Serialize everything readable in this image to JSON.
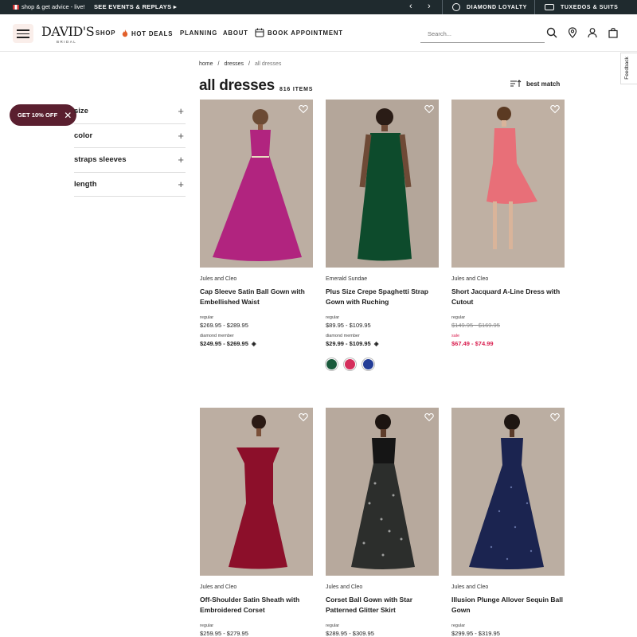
{
  "topbar": {
    "promo_text": "shop & get advice - live!",
    "events_text": "SEE EVENTS & REPLAYS",
    "prev_glyph": "‹",
    "next_glyph": "›",
    "loyalty_label": "DIAMOND LOYALTY",
    "tuxedos_label": "TUXEDOS & SUITS"
  },
  "header": {
    "logo": "DAVID'S",
    "logo_sub": "BRIDAL",
    "nav": {
      "shop": "SHOP",
      "hot_deals": "HOT DEALS",
      "planning": "PLANNING",
      "about": "ABOUT",
      "book": "BOOK APPOINTMENT"
    },
    "search_placeholder": "Search..."
  },
  "feedback_label": "Feedback",
  "breadcrumb": {
    "home": "home",
    "sep1": "/",
    "dresses": "dresses",
    "sep2": "/",
    "current": "all dresses"
  },
  "page": {
    "title": "all dresses",
    "count": "816 ITEMS",
    "sort_label": "best match"
  },
  "promo_pill": {
    "label": "GET 10% OFF",
    "close": "✕"
  },
  "filters": [
    {
      "label": "size",
      "plus": "+"
    },
    {
      "label": "color",
      "plus": "+"
    },
    {
      "label": "straps sleeves",
      "plus": "+"
    },
    {
      "label": "length",
      "plus": "+"
    }
  ],
  "colors": {
    "topbar_bg": "#1f2a2e",
    "pill_bg": "#5a1f2f",
    "sale_red": "#d91e4f",
    "image_bg": "#b9ab9e"
  },
  "products": [
    {
      "brand": "Jules and Cleo",
      "name": "Cap Sleeve Satin Ball Gown with Embellished Waist",
      "regular_label": "regular",
      "regular_price": "$269.95 - $289.95",
      "member_label": "diamond member",
      "member_price": "$249.95 - $269.95",
      "dress_color": "#b1247f"
    },
    {
      "brand": "Emerald Sundae",
      "name": "Plus Size Crepe Spaghetti Strap Gown with Ruching",
      "regular_label": "regular",
      "regular_price": "$89.95 - $109.95",
      "member_label": "diamond member",
      "member_price": "$29.99 - $109.95",
      "dress_color": "#0d4b2c",
      "swatches": [
        "#1a5a3c",
        "#d52e5c",
        "#233d97"
      ]
    },
    {
      "brand": "Jules and Cleo",
      "name": "Short Jacquard A-Line Dress with Cutout",
      "regular_label": "regular",
      "regular_price": "$149.95 - $169.95",
      "member_label": "sale",
      "member_price": "$67.49 - $74.99",
      "dress_color": "#e86f78"
    },
    {
      "brand": "Jules and Cleo",
      "name": "Off-Shoulder Satin Sheath with Embroidered Corset",
      "regular_label": "regular",
      "regular_price": "$259.95 - $279.95",
      "dress_color": "#8c0f2a"
    },
    {
      "brand": "Jules and Cleo",
      "name": "Corset Ball Gown with Star Patterned Glitter Skirt",
      "regular_label": "regular",
      "regular_price": "$289.95 - $309.95",
      "dress_color": "#2c2e2c"
    },
    {
      "brand": "Jules and Cleo",
      "name": "Illusion Plunge Allover Sequin Ball Gown",
      "regular_label": "regular",
      "regular_price": "$299.95 - $319.95",
      "dress_color": "#1b2450"
    }
  ]
}
